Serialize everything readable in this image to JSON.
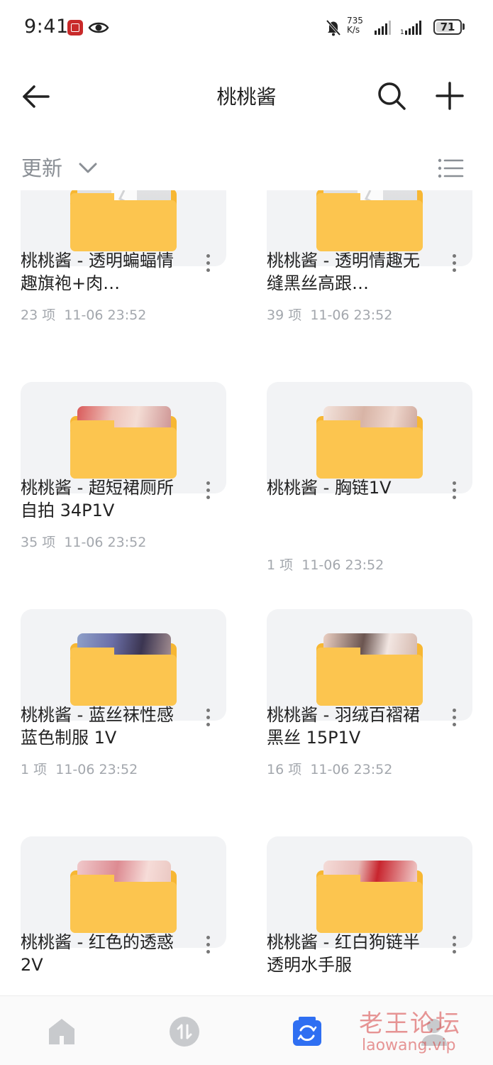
{
  "status_bar": {
    "time": "9:41",
    "net_speed_value": "735",
    "net_speed_unit": "K/s",
    "battery": "71",
    "battery_level_percent": 71,
    "icons": [
      "app-notification-icon",
      "eye-icon",
      "bell-mute-icon",
      "signal-icon",
      "signal-icon"
    ]
  },
  "header": {
    "title": "桃桃酱",
    "icons": [
      "back-arrow-icon",
      "search-icon",
      "plus-icon"
    ]
  },
  "sort_bar": {
    "label": "更新",
    "icons": [
      "chevron-down-icon",
      "list-view-icon"
    ]
  },
  "folders": [
    {
      "title": "桃桃酱 - 透明蝙蝠情趣旗袍+肉…",
      "count": "23 项",
      "date": "11-06 23:52",
      "preview": "blank"
    },
    {
      "title": "桃桃酱 - 透明情趣无缝黑丝高跟…",
      "count": "39 项",
      "date": "11-06 23:52",
      "preview": "blank"
    },
    {
      "title": "桃桃酱 - 超短裙厕所自拍 34P1V",
      "count": "35 项",
      "date": "11-06 23:52",
      "preview": "photo"
    },
    {
      "title": "桃桃酱 - 胸链1V",
      "count": "1 项",
      "date": "11-06 23:52",
      "preview": "photo"
    },
    {
      "title": "桃桃酱 - 蓝丝袜性感蓝色制服 1V",
      "count": "1 项",
      "date": "11-06 23:52",
      "preview": "photo"
    },
    {
      "title": "桃桃酱 - 羽绒百褶裙黑丝 15P1V",
      "count": "16 项",
      "date": "11-06 23:52",
      "preview": "photo"
    },
    {
      "title": "桃桃酱 - 红色的透惑 2V",
      "count": "",
      "date": "",
      "preview": "photo"
    },
    {
      "title": "桃桃酱 - 红白狗链半透明水手服",
      "count": "",
      "date": "",
      "preview": "photo"
    }
  ],
  "bottom_nav": {
    "items": [
      "home-icon",
      "transfer-icon",
      "files-icon",
      "profile-icon"
    ],
    "active_index": 2
  },
  "watermark": {
    "cn": "老王论坛",
    "en": "laowang.vip"
  },
  "colors": {
    "folder": "#fcc54f",
    "folder_back": "#f7b733",
    "active_nav": "#2f6ff2",
    "meta_text": "#a3a7ad",
    "thumb_bg": "#f2f3f5"
  }
}
